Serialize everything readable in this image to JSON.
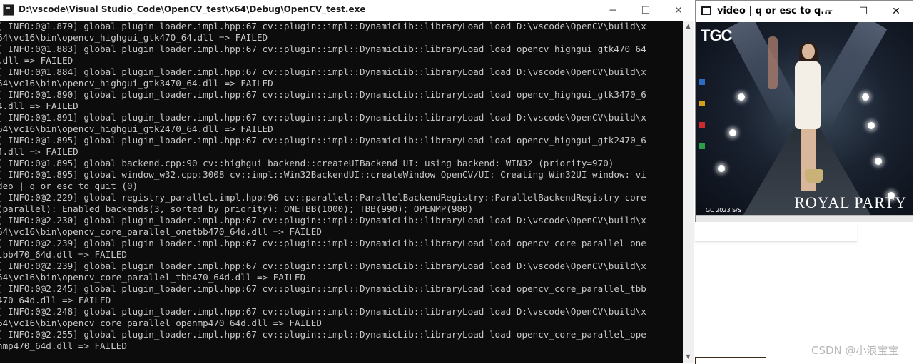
{
  "console_window": {
    "title": "D:\\vscode\\Visual Studio_Code\\OpenCV_test\\x64\\Debug\\OpenCV_test.exe",
    "min_glyph": "─",
    "max_glyph": "☐",
    "close_glyph": "✕",
    "lines": [
      "[ INFO:0@1.879] global plugin_loader.impl.hpp:67 cv::plugin::impl::DynamicLib::libraryLoad load D:\\vscode\\OpenCV\\build\\x",
      "64\\vc16\\bin\\opencv_highgui_gtk470_64.dll => FAILED",
      "[ INFO:0@1.883] global plugin_loader.impl.hpp:67 cv::plugin::impl::DynamicLib::libraryLoad load opencv_highgui_gtk470_64",
      ".dll => FAILED",
      "[ INFO:0@1.884] global plugin_loader.impl.hpp:67 cv::plugin::impl::DynamicLib::libraryLoad load D:\\vscode\\OpenCV\\build\\x",
      "64\\vc16\\bin\\opencv_highgui_gtk3470_64.dll => FAILED",
      "[ INFO:0@1.890] global plugin_loader.impl.hpp:67 cv::plugin::impl::DynamicLib::libraryLoad load opencv_highgui_gtk3470_6",
      "4.dll => FAILED",
      "[ INFO:0@1.891] global plugin_loader.impl.hpp:67 cv::plugin::impl::DynamicLib::libraryLoad load D:\\vscode\\OpenCV\\build\\x",
      "64\\vc16\\bin\\opencv_highgui_gtk2470_64.dll => FAILED",
      "[ INFO:0@1.895] global plugin_loader.impl.hpp:67 cv::plugin::impl::DynamicLib::libraryLoad load opencv_highgui_gtk2470_6",
      "4.dll => FAILED",
      "[ INFO:0@1.895] global backend.cpp:90 cv::highgui_backend::createUIBackend UI: using backend: WIN32 (priority=970)",
      "[ INFO:0@1.895] global window_w32.cpp:3008 cv::impl::Win32BackendUI::createWindow OpenCV/UI: Creating Win32UI window: vi",
      "deo | q or esc to quit (0)",
      "[ INFO:0@2.229] global registry_parallel.impl.hpp:96 cv::parallel::ParallelBackendRegistry::ParallelBackendRegistry core",
      "(parallel): Enabled backends(3, sorted by priority): ONETBB(1000); TBB(990); OPENMP(980)",
      "[ INFO:0@2.230] global plugin_loader.impl.hpp:67 cv::plugin::impl::DynamicLib::libraryLoad load D:\\vscode\\OpenCV\\build\\x",
      "64\\vc16\\bin\\opencv_core_parallel_onetbb470_64d.dll => FAILED",
      "[ INFO:0@2.239] global plugin_loader.impl.hpp:67 cv::plugin::impl::DynamicLib::libraryLoad load opencv_core_parallel_one",
      "tbb470_64d.dll => FAILED",
      "[ INFO:0@2.239] global plugin_loader.impl.hpp:67 cv::plugin::impl::DynamicLib::libraryLoad load D:\\vscode\\OpenCV\\build\\x",
      "64\\vc16\\bin\\opencv_core_parallel_tbb470_64d.dll => FAILED",
      "[ INFO:0@2.245] global plugin_loader.impl.hpp:67 cv::plugin::impl::DynamicLib::libraryLoad load opencv_core_parallel_tbb",
      "470_64d.dll => FAILED",
      "[ INFO:0@2.248] global plugin_loader.impl.hpp:67 cv::plugin::impl::DynamicLib::libraryLoad load D:\\vscode\\OpenCV\\build\\x",
      "64\\vc16\\bin\\opencv_core_parallel_openmp470_64d.dll => FAILED",
      "[ INFO:0@2.255] global plugin_loader.impl.hpp:67 cv::plugin::impl::DynamicLib::libraryLoad load opencv_core_parallel_ope",
      "nmp470_64d.dll => FAILED"
    ],
    "scroll_up": "▲",
    "scroll_down": "▼"
  },
  "video_window": {
    "title": "video | q or esc to q...",
    "min_glyph": "─",
    "max_glyph": "☐",
    "close_glyph": "✕",
    "frame_text": {
      "logo": "TGC",
      "brand": "ROYAL PARTY",
      "caption": "TGC 2023 S/S"
    }
  },
  "watermark": "CSDN @小浪宝宝",
  "colors": {
    "console_bg": "#0c0c0c",
    "console_text": "#c8c8c8",
    "titlebar_bg": "#ffffff"
  }
}
